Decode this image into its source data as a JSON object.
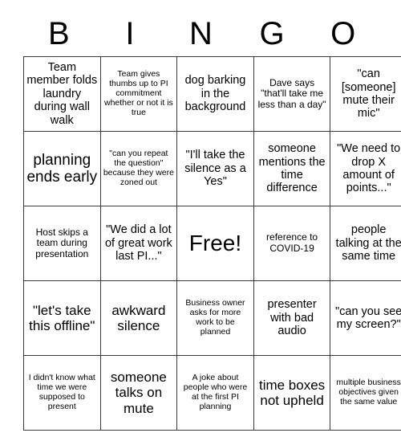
{
  "card": {
    "header_letters": [
      "B",
      "I",
      "N",
      "G",
      "O"
    ],
    "rows": [
      [
        {
          "text": "Team member folds laundry during wall walk",
          "size": "sz-m",
          "free": false
        },
        {
          "text": "Team gives thumbs up to PI commitment whether or not it is true",
          "size": "sz-xs",
          "free": false
        },
        {
          "text": "dog barking in the background",
          "size": "sz-m",
          "free": false
        },
        {
          "text": "Dave says \"that'll take me less than a day\"",
          "size": "sz-s",
          "free": false
        },
        {
          "text": "\"can [someone] mute their mic\"",
          "size": "sz-m",
          "free": false
        }
      ],
      [
        {
          "text": "planning ends early",
          "size": "sz-xl",
          "free": false
        },
        {
          "text": "\"can you repeat the question\" because they were zoned out",
          "size": "sz-xs",
          "free": false
        },
        {
          "text": "\"I'll take the silence as a Yes\"",
          "size": "sz-m",
          "free": false
        },
        {
          "text": "someone mentions the time difference",
          "size": "sz-m",
          "free": false
        },
        {
          "text": "\"We need to drop X amount of points...\"",
          "size": "sz-m",
          "free": false
        }
      ],
      [
        {
          "text": "Host skips a team during presentation",
          "size": "sz-s",
          "free": false
        },
        {
          "text": "\"We did a lot of great work last PI...\"",
          "size": "sz-m",
          "free": false
        },
        {
          "text": "Free!",
          "size": "sz-free",
          "free": true
        },
        {
          "text": "reference to COVID-19",
          "size": "sz-s",
          "free": false
        },
        {
          "text": "people talking at the same time",
          "size": "sz-m",
          "free": false
        }
      ],
      [
        {
          "text": "\"let's take this offline\"",
          "size": "sz-l",
          "free": false
        },
        {
          "text": "awkward silence",
          "size": "sz-l",
          "free": false
        },
        {
          "text": "Business owner asks for more work to be planned",
          "size": "sz-xs",
          "free": false
        },
        {
          "text": "presenter with bad audio",
          "size": "sz-m",
          "free": false
        },
        {
          "text": "\"can you see my screen?\"",
          "size": "sz-m",
          "free": false
        }
      ],
      [
        {
          "text": "I didn't know what time we were supposed to present",
          "size": "sz-xs",
          "free": false
        },
        {
          "text": "someone talks on mute",
          "size": "sz-l",
          "free": false
        },
        {
          "text": "A joke about people who were at the first PI planning",
          "size": "sz-xs",
          "free": false
        },
        {
          "text": "time boxes not upheld",
          "size": "sz-l",
          "free": false
        },
        {
          "text": "multiple business objectives given the same value",
          "size": "sz-xs",
          "free": false
        }
      ]
    ]
  },
  "colors": {
    "background": "#ffffff",
    "text": "#000000",
    "grid_line": "#3a3a3a"
  }
}
